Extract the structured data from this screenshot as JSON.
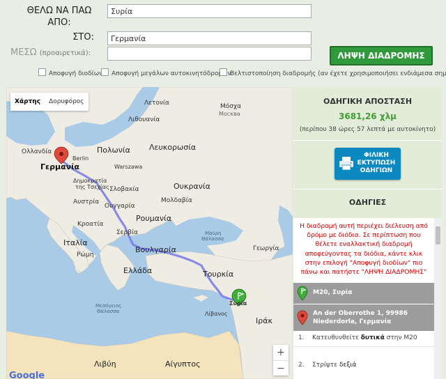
{
  "form": {
    "from_label_1": "ΘΕΛΩ ΝΑ ΠΑΩ",
    "from_label_2": "ΑΠΟ:",
    "to_label": "ΣΤΟ:",
    "via_label": "ΜΕΣΩ",
    "via_note": "(προαιρετικά):",
    "from_value": "Συρία",
    "to_value": "Γερμανία",
    "via_value": "",
    "submit_label": "ΛΗΨΗ ΔΙΑΔΡΟΜΗΣ",
    "options": [
      {
        "label": "Αποφυγή διοδίων",
        "checked": false
      },
      {
        "label": "Αποφυγή μεγάλων αυτοκινητόδρομων",
        "checked": false
      },
      {
        "label": "Βελτιστοποίηση διαδρομής (αν έχετε χρησιμοποιήσει ενδιάμεσα σημεία)",
        "checked": false
      }
    ]
  },
  "map": {
    "tab_map": "Χάρτης",
    "tab_satellite": "Δορυφόρος",
    "zoom_in": "+",
    "zoom_out": "−",
    "logo": "Google",
    "labels": {
      "latvia": "Λετονία",
      "lithuania": "Λιθουανία",
      "moscow": "Μόσχα",
      "moscow_native": "Москва",
      "belarus": "Λευκορωσία",
      "poland": "Πολωνία",
      "warsaw": "Warszawa",
      "berlin": "Berlin",
      "holland": "Ολλανδία",
      "germany": "Γερμανία",
      "czech_1": "Δημοκρατία",
      "czech_2": "της Τσεχίας",
      "slovakia": "Σλοβακία",
      "ukraine": "Ουκρανία",
      "austria": "Αυστρία",
      "hungary": "Ουγγαρία",
      "moldova": "Μολδαβία",
      "croatia": "Κροατία",
      "romania": "Ρουμανία",
      "serbia": "Σερβία",
      "black_sea_1": "Μαύρη",
      "black_sea_2": "Θάλασσα",
      "italy": "Ιταλία",
      "rome": "Ρώμη",
      "bulgaria": "Βουλγαρία",
      "georgia": "Γεωργία",
      "greece": "Ελλάδα",
      "turkey": "Τουρκία",
      "med_1": "Μεσόγειος",
      "med_2": "Θάλασσα",
      "syria": "Συρία",
      "lebanon": "Λίβανος",
      "iraq": "Ιράκ",
      "libya": "Λιβύη",
      "egypt": "Αίγυπτος"
    }
  },
  "summary": {
    "title": "ΟΔΗΓΙΚΗ ΑΠΟΣΤΑΣΗ",
    "distance": "3681,26 χλμ",
    "duration": "(περίπου 38 ώρες 57 λεπτά με αυτοκίνητο)",
    "print_line_1": "ΦΙΛΙΚΗ",
    "print_line_2": "ΕΚΤΥΠΩΣΗ",
    "print_line_3": "ΟΔΗΓΙΩΝ",
    "instructions_title": "ΟΔΗΓΙΕΣ"
  },
  "directions": {
    "notice": "Η διαδρομή αυτή περιέχει διέλευση από δρόμο με διόδια. Σε περίπτωση που θέλετε εναλλακτική διαδρομή αποφεύγοντας τα διόδια, κάντε κλικ στην επιλογή \"Αποφυγή διοδίων\" πιο πάνω και πατήστε \"ΛΗΨΗ ΔΙΑΔΡΟΜΗΣ\"",
    "start": "M20, Συρία",
    "end_1": "An der Oberrothe 1, 99986",
    "end_2": "Niederdorla, Γερμανία",
    "steps": [
      {
        "num": "1.",
        "pre": "Κατευθυνθείτε ",
        "bold": "δυτικά",
        "mid": " στην ",
        "tail": "M20"
      },
      {
        "num": "2.",
        "pre": "Στρίψτε ",
        "bold": "δεξιά",
        "mid": "",
        "tail": ""
      }
    ]
  },
  "colors": {
    "green_button": "#2e9a3a",
    "print_button": "#0d89c1",
    "route": "#7b80e6",
    "notice_red": "#cc0000",
    "summary_green": "#3f9f33"
  }
}
